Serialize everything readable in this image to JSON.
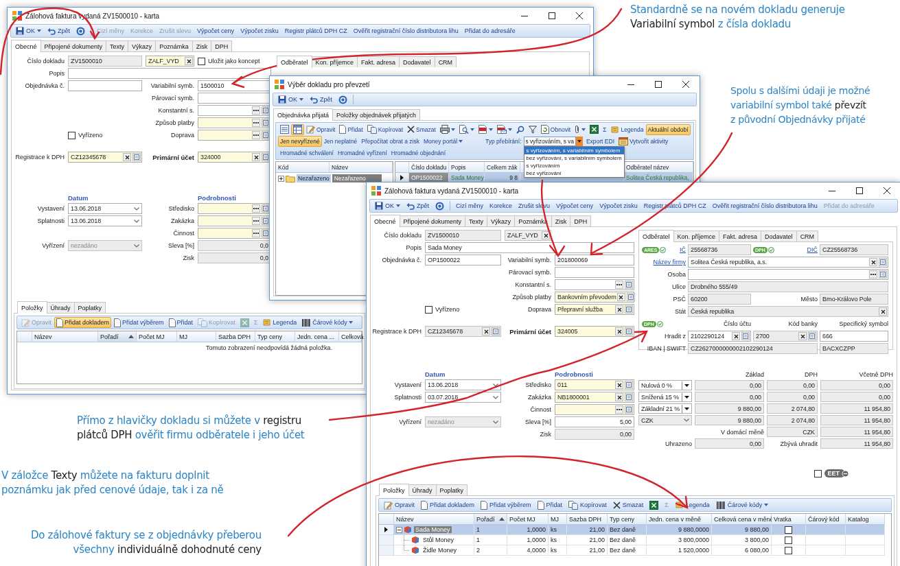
{
  "annotations": [
    {
      "lines": [
        [
          {
            "text": "Standardně se na novém dokladu generuje",
            "term": false
          }
        ],
        [
          {
            "text": "Variabilní symbol",
            "term": true
          },
          {
            "text": "z čísla dokladu",
            "term": false
          }
        ]
      ]
    },
    {
      "lines": [
        [
          {
            "text": "Spolu s dalšími údaji je možné",
            "term": false
          }
        ],
        [
          {
            "text": "variabilní symbol také",
            "term": false
          },
          {
            "text": "převzít",
            "term": true
          }
        ],
        [
          {
            "text": "z původní Objednávky přijaté",
            "term": false
          }
        ]
      ]
    },
    {
      "lines": [
        [
          {
            "text": "Přímo z hlavičky dokladu si můžete v",
            "term": false
          },
          {
            "text": "registru",
            "term": true
          }
        ],
        [
          {
            "text": "plátců DPH",
            "term": true
          },
          {
            "text": "ověřit firmu odběratele i jeho účet",
            "term": false
          }
        ]
      ]
    },
    {
      "lines": [
        [
          {
            "text": "V záložce",
            "term": false
          },
          {
            "text": "Texty",
            "term": true
          },
          {
            "text": "můžete na fakturu doplnit",
            "term": false
          }
        ],
        [
          {
            "text": "poznámku jak před cenové údaje, tak i za ně",
            "term": false
          }
        ]
      ]
    },
    {
      "lines": [
        [
          {
            "text": "Do zálohové faktury se z objednávky přeberou",
            "term": false
          }
        ],
        [
          {
            "text": "všechny",
            "term": false
          },
          {
            "text": "individuálně dohodnuté ceny",
            "term": true
          }
        ]
      ]
    }
  ],
  "invoice_window_back": {
    "title": "Zálohová faktura vydaná ZV1500010 - karta",
    "toolbar": [
      {
        "kind": "save",
        "label": "OK",
        "disabled": false
      },
      {
        "kind": "undo",
        "label": "Zpět",
        "disabled": false
      },
      {
        "kind": "help",
        "disabled": false
      },
      {
        "kind": "text",
        "label": "Cizí měny",
        "disabled": true
      },
      {
        "kind": "text",
        "label": "Korekce",
        "disabled": true
      },
      {
        "kind": "text",
        "label": "Zrušit slevu",
        "disabled": true
      },
      {
        "kind": "text",
        "label": "Výpočet ceny",
        "disabled": false
      },
      {
        "kind": "text",
        "label": "Výpočet zisku",
        "disabled": false
      },
      {
        "kind": "text",
        "label": "Registr plátců DPH CZ",
        "disabled": false
      },
      {
        "kind": "text",
        "label": "Ověřit registrační číslo distributora lihu",
        "disabled": false
      },
      {
        "kind": "text",
        "label": "Přidat do adresáře",
        "disabled": false
      }
    ],
    "tabs": [
      {
        "label": "Obecné",
        "selected": true
      },
      {
        "label": "Připojené dokumenty",
        "selected": false
      },
      {
        "label": "Texty",
        "selected": false
      },
      {
        "label": "Výkazy",
        "selected": false
      },
      {
        "label": "Poznámka",
        "selected": false
      },
      {
        "label": "Zisk",
        "selected": false
      },
      {
        "label": "DPH",
        "selected": false
      }
    ],
    "form": [
      [
        {
          "c1": {
            "kind": "label",
            "text": "Číslo dokladu",
            "bold": false
          },
          "c2": {
            "kind": "readonly",
            "value": "ZV1500010"
          },
          "c3": {
            "kind": "clear",
            "value": "ZALF_VYD",
            "required": true
          },
          "c4": {
            "kind": "check",
            "label": "Uložit jako koncept",
            "checked": false
          }
        },
        {
          "c1": {
            "kind": "label",
            "text": "Popis",
            "bold": false
          },
          "c2": {
            "kind": "text"
          }
        },
        {
          "c1": {
            "kind": "label",
            "text": "Objednávka č.",
            "bold": false
          },
          "c2": {
            "kind": "text"
          },
          "c3": {
            "kind": "label",
            "text": "Variabilní symb.",
            "bold": false
          },
          "c4": {
            "kind": "text",
            "value": "1500010"
          }
        },
        {
          "c3": {
            "kind": "label",
            "text": "Párovací symb.",
            "bold": false
          },
          "c4": {
            "kind": "text"
          }
        },
        {
          "c3": {
            "kind": "label",
            "text": "Konstantní s.",
            "bold": false
          },
          "c4": {
            "kind": "lookup_dots",
            "required": false
          }
        },
        {
          "c3": {
            "kind": "label",
            "text": "Způsob platby",
            "bold": false
          },
          "c4": {
            "kind": "lookup_dots",
            "required": true
          }
        },
        {
          "c2": {
            "kind": "check",
            "label": "Vyřízeno",
            "checked": false
          },
          "c3": {
            "kind": "label",
            "text": "Doprava",
            "bold": false
          },
          "c4": {
            "kind": "lookup_dots",
            "required": true
          }
        }
      ],
      [
        {
          "c1": {
            "kind": "label",
            "text": "Registrace k DPH",
            "bold": false
          },
          "c2": {
            "kind": "lookup_x",
            "value": "CZ12345678",
            "required": true
          },
          "c3": {
            "kind": "label",
            "text": "Primární účet",
            "bold": true
          },
          "c4": {
            "kind": "lookup_x",
            "value": "324000",
            "required": true
          }
        }
      ]
    ],
    "partner_tabs": [
      {
        "label": "Odběratel",
        "selected": true
      },
      {
        "label": "Kon. příjemce",
        "selected": false
      },
      {
        "label": "Fakt. adresa",
        "selected": false
      },
      {
        "label": "Dodavatel",
        "selected": false
      },
      {
        "label": "CRM",
        "selected": false
      }
    ],
    "dates": [
      [
        {
          "c2": {
            "kind": "heading",
            "text": "Datum"
          },
          "c4": {
            "kind": "heading",
            "text": "Podrobnosti"
          }
        },
        {
          "c1": {
            "kind": "label",
            "text": "Vystavení"
          },
          "c2": {
            "kind": "date",
            "value": "13.06.2018"
          },
          "c3": {
            "kind": "label",
            "text": "Středisko"
          },
          "c4": {
            "kind": "lookup_dots",
            "required": true
          }
        },
        {
          "c1": {
            "kind": "label",
            "text": "Splatnosti"
          },
          "c2": {
            "kind": "date",
            "value": "13.06.2018"
          },
          "c3": {
            "kind": "label",
            "text": "Zakázka"
          },
          "c4": {
            "kind": "lookup_dots",
            "required": true
          }
        },
        {
          "c3": {
            "kind": "label",
            "text": "Činnost"
          },
          "c4": {
            "kind": "lookup_dots",
            "required": true
          }
        },
        {
          "c1": {
            "kind": "label",
            "text": "Vyřízení"
          },
          "c2": {
            "kind": "select_disabled",
            "value": "nezadáno"
          },
          "c3": {
            "kind": "label",
            "text": "Sleva [%]"
          },
          "c4": {
            "kind": "number_ro",
            "value": "0,0"
          }
        },
        {
          "c3": {
            "kind": "label",
            "text": "Zisk"
          },
          "c4": {
            "kind": "number_ro",
            "value": "0,0"
          }
        }
      ]
    ],
    "items_tabs": [
      {
        "label": "Položky",
        "selected": true
      },
      {
        "label": "Úhrady",
        "selected": false
      },
      {
        "label": "Poplatky",
        "selected": false
      }
    ],
    "items_toolbar": [
      {
        "kind": "edit",
        "label": "Opravit",
        "disabled": true,
        "active": false
      },
      {
        "kind": "add",
        "label": "Přidat dokladem",
        "disabled": false,
        "active": true
      },
      {
        "kind": "add",
        "label": "Přidat výběrem",
        "disabled": false,
        "active": false
      },
      {
        "kind": "add",
        "label": "Přidat",
        "disabled": false,
        "active": false
      },
      {
        "kind": "copy",
        "label": "Kopírovat",
        "disabled": true,
        "active": false
      },
      {
        "kind": "excel",
        "disabled": true,
        "active": false
      },
      {
        "kind": "sum",
        "label": "Σ",
        "disabled": true,
        "active": false
      },
      {
        "kind": "legend",
        "label": "Legenda",
        "disabled": false,
        "active": false
      },
      {
        "kind": "barcode",
        "label": "Čárové kódy",
        "disabled": false,
        "active": false
      }
    ],
    "items_table": {
      "columns": [
        {
          "label": "Název",
          "sorted": false
        },
        {
          "label": "Pořadí",
          "sorted": true
        },
        {
          "label": "Počet MJ",
          "sorted": false
        },
        {
          "label": "MJ",
          "sorted": false
        },
        {
          "label": "Sazba DPH",
          "sorted": false
        },
        {
          "label": "Typ ceny",
          "sorted": false
        },
        {
          "label": "Jedn. cena ...",
          "sorted": false
        },
        {
          "label": "Celková",
          "sorted": false
        }
      ],
      "empty_message": "Tomuto zobrazení neodpovídá žádná položka."
    }
  },
  "selection_window": {
    "title": "Výběr dokladu pro převzetí",
    "toolbar": [
      {
        "kind": "save",
        "label": "OK",
        "disabled": false
      },
      {
        "kind": "undo",
        "label": "Zpět",
        "disabled": false
      },
      {
        "kind": "help",
        "disabled": false
      }
    ],
    "tabs": [
      {
        "label": "Objednávka přijatá",
        "selected": true
      },
      {
        "label": "Položky objednávek přijatých",
        "selected": false
      }
    ],
    "toolbar_rows": [
      [
        {
          "kind": "view_list",
          "active": false
        },
        {
          "kind": "view_tree",
          "active": true
        },
        {
          "kind": "edit",
          "label": "Opravit",
          "active": false
        },
        {
          "kind": "add",
          "label": "Přidat",
          "active": false
        },
        {
          "kind": "copy",
          "label": "Kopírovat",
          "active": false
        },
        {
          "kind": "delete",
          "label": "Smazat",
          "active": false
        },
        {
          "kind": "print",
          "active": false
        },
        {
          "kind": "preview",
          "active": false
        },
        {
          "kind": "pdf",
          "active": false
        },
        {
          "kind": "pdf_mail",
          "active": false
        },
        {
          "kind": "find",
          "active": false
        },
        {
          "kind": "filter",
          "active": false
        },
        {
          "kind": "refresh",
          "label": "Obnovit",
          "active": false
        },
        {
          "kind": "attach",
          "active": false
        },
        {
          "kind": "excel",
          "active": false
        },
        {
          "kind": "sum",
          "label": "Σ",
          "active": false
        },
        {
          "kind": "legend",
          "label": "Legenda",
          "active": false
        },
        {
          "kind": "text",
          "label": "Aktuální období",
          "active": true
        }
      ],
      [
        {
          "kind": "text",
          "label": "Jen nevyřízené",
          "active": true
        },
        {
          "kind": "text",
          "label": "Jen neplatné",
          "active": false
        },
        {
          "kind": "text",
          "label": "Přepočítat obrat a zisk",
          "active": false
        },
        {
          "kind": "dropdown",
          "label": "Money portál",
          "active": false
        },
        {
          "kind": "combo",
          "label": "Typ přebírání:",
          "value": "s vyřizováním, s va",
          "expanded": true,
          "options": [
            {
              "label": "s vyřizováním, s variabilním symbolem",
              "selected": true
            },
            {
              "label": "bez vyřizování, s variabilním symbolem",
              "selected": false
            },
            {
              "label": "s vyřizováním",
              "selected": false
            },
            {
              "label": "bez vyřizování",
              "selected": false
            }
          ]
        },
        {
          "kind": "text",
          "label": "Export EDI",
          "active": false
        },
        {
          "kind": "activity",
          "label": "Vytvořit aktivity",
          "active": false
        }
      ],
      [
        {
          "kind": "text",
          "label": "Hromadné schválení",
          "active": false
        },
        {
          "kind": "text",
          "label": "Hromadné vyřízení",
          "active": false
        },
        {
          "kind": "text",
          "label": "Hromadné objednání",
          "active": false
        }
      ]
    ],
    "tree": {
      "columns": [
        "Kód",
        "Název"
      ],
      "rows": [
        {
          "code": "Nezařazeno",
          "name": "Nezařazeno",
          "expanded": false,
          "selected": true
        }
      ]
    },
    "grid": {
      "columns": [
        "Číslo dokladu",
        "Popis",
        "Celkem zák",
        "Odběratel název"
      ],
      "rows": [
        {
          "cells": [
            "OP1500022",
            "Sada Money",
            "9 8",
            "Solitea Česká republika,"
          ],
          "selected": true
        }
      ]
    }
  },
  "invoice_window_front": {
    "title": "Zálohová faktura vydaná ZV1500010 - karta",
    "toolbar": [
      {
        "kind": "save",
        "label": "OK",
        "disabled": false
      },
      {
        "kind": "undo",
        "label": "Zpět",
        "disabled": false
      },
      {
        "kind": "help",
        "disabled": false
      },
      {
        "kind": "text",
        "label": "Cizí měny",
        "disabled": false
      },
      {
        "kind": "text",
        "label": "Korekce",
        "disabled": false
      },
      {
        "kind": "text",
        "label": "Zrušit slevu",
        "disabled": false
      },
      {
        "kind": "text",
        "label": "Výpočet ceny",
        "disabled": false
      },
      {
        "kind": "text",
        "label": "Výpočet zisku",
        "disabled": false
      },
      {
        "kind": "text",
        "label": "Registr plátců DPH CZ",
        "disabled": false
      },
      {
        "kind": "text",
        "label": "Ověřit registrační číslo distributora lihu",
        "disabled": false
      },
      {
        "kind": "text",
        "label": "Přidat do adresáře",
        "disabled": true
      }
    ],
    "tabs": [
      {
        "label": "Obecné",
        "selected": true
      },
      {
        "label": "Připojené dokumenty",
        "selected": false
      },
      {
        "label": "Texty",
        "selected": false
      },
      {
        "label": "Výkazy",
        "selected": false
      },
      {
        "label": "Poznámka",
        "selected": false
      },
      {
        "label": "Zisk",
        "selected": false
      },
      {
        "label": "DPH",
        "selected": false
      }
    ],
    "form": [
      [
        {
          "c1": {
            "kind": "label",
            "text": "Číslo dokladu",
            "bold": false
          },
          "c2": {
            "kind": "readonly",
            "value": "ZV1500010"
          },
          "c3": {
            "kind": "readonly_x",
            "value": "ZALF_VYD"
          }
        },
        {
          "c1": {
            "kind": "label",
            "text": "Popis",
            "bold": false
          },
          "c2": {
            "kind": "text",
            "value": "Sada Money"
          }
        },
        {
          "c1": {
            "kind": "label",
            "text": "Objednávka č.",
            "bold": false
          },
          "c2": {
            "kind": "text",
            "value": "OP1500022"
          },
          "c3": {
            "kind": "label",
            "text": "Variabilní symb.",
            "bold": false
          },
          "c4": {
            "kind": "text",
            "value": "201800069"
          }
        },
        {
          "c3": {
            "kind": "label",
            "text": "Párovací symb.",
            "bold": false
          },
          "c4": {
            "kind": "text"
          }
        },
        {
          "c3": {
            "kind": "label",
            "text": "Konstantní s.",
            "bold": false
          },
          "c4": {
            "kind": "lookup_dots",
            "required": false
          }
        },
        {
          "c3": {
            "kind": "label",
            "text": "Způsob platby",
            "bold": false
          },
          "c4": {
            "kind": "lookup_x",
            "value": "Bankovním převodem",
            "required": true
          }
        },
        {
          "c2": {
            "kind": "check",
            "label": "Vyřízeno",
            "checked": false
          },
          "c3": {
            "kind": "label",
            "text": "Doprava",
            "bold": false
          },
          "c4": {
            "kind": "lookup_x",
            "value": "Přepravní služba",
            "required": true
          }
        }
      ],
      [
        {
          "c1": {
            "kind": "label",
            "text": "Registrace k DPH",
            "bold": false
          },
          "c2": {
            "kind": "readonly_xl",
            "value": "CZ12345678"
          },
          "c3": {
            "kind": "label",
            "text": "Primární účet",
            "bold": true
          },
          "c4": {
            "kind": "lookup_x",
            "value": "324005",
            "required": true
          }
        }
      ]
    ],
    "partner_tabs": [
      {
        "label": "Odběratel",
        "selected": true
      },
      {
        "label": "Kon. příjemce",
        "selected": false
      },
      {
        "label": "Fakt. adresa",
        "selected": false
      },
      {
        "label": "Dodavatel",
        "selected": false
      },
      {
        "label": "CRM",
        "selected": false
      }
    ],
    "partner_form": [
      [
        {
          "c1": {
            "kind": "label",
            "badge": "ARES",
            "text": "IČ",
            "link": true
          },
          "c2": {
            "kind": "readonly",
            "value": "25568736"
          },
          "c3": {
            "kind": "label",
            "badge": "DPH",
            "text": "DIČ",
            "link": true
          },
          "c4": {
            "kind": "readonly",
            "value": "CZ25568736"
          }
        },
        {
          "c1": {
            "kind": "label",
            "text": "Název firmy",
            "link": true
          },
          "c2": {
            "kind": "lookup_x",
            "value": "Solitea Česká republika, a.s."
          }
        },
        {
          "c1": {
            "kind": "label",
            "text": "Osoba",
            "link": false
          },
          "c2": {
            "kind": "lookup_dots"
          }
        },
        {
          "c1": {
            "kind": "label",
            "text": "Ulice",
            "link": false
          },
          "c2": {
            "kind": "readonly",
            "value": "Drobného 555/49"
          }
        },
        {
          "c1": {
            "kind": "label",
            "text": "PSČ",
            "link": false
          },
          "c2": {
            "kind": "readonly",
            "value": "60200"
          },
          "c3": {
            "kind": "label",
            "text": "Město",
            "link": false
          },
          "c4": {
            "kind": "readonly",
            "value": "Brno-Královo Pole"
          }
        },
        {
          "c1": {
            "kind": "label",
            "text": "Stát",
            "link": false
          },
          "c2": {
            "kind": "readonly_x",
            "value": "Česká republika"
          }
        },
        {
          "c1": {
            "kind": "label",
            "badge": "DPH"
          },
          "c2": {
            "kind": "colhead",
            "text": "Číslo účtu"
          },
          "c3": {
            "kind": "colhead",
            "text": "Kód banky"
          },
          "c4": {
            "kind": "colhead",
            "text": "Specifický symbol"
          }
        },
        {
          "c1": {
            "kind": "label",
            "text": "Hradit z",
            "link": false
          },
          "c2": {
            "kind": "lookup_x",
            "value": "2102290124"
          },
          "c3": {
            "kind": "readonly_xl",
            "value": "2700"
          },
          "c4": {
            "kind": "text",
            "value": "666"
          }
        },
        {
          "c1": {
            "kind": "label",
            "text": "IBAN | SWIFT",
            "link": false
          },
          "c2": {
            "kind": "readonly",
            "value": "CZ2627000000002102290124"
          },
          "c4": {
            "kind": "readonly",
            "value": "BACXCZPP"
          }
        }
      ]
    ],
    "dates": [
      [
        {
          "c2": {
            "kind": "heading",
            "text": "Datum"
          },
          "c4": {
            "kind": "heading",
            "text": "Podrobnosti"
          }
        },
        {
          "c1": {
            "kind": "label",
            "text": "Vystavení"
          },
          "c2": {
            "kind": "date",
            "value": "13.06.2018"
          },
          "c3": {
            "kind": "label",
            "text": "Středisko"
          },
          "c4": {
            "kind": "lookup_x",
            "value": "011",
            "required": true
          }
        },
        {
          "c1": {
            "kind": "label",
            "text": "Splatnosti"
          },
          "c2": {
            "kind": "date",
            "value": "03.07.2018"
          },
          "c3": {
            "kind": "label",
            "text": "Zakázka"
          },
          "c4": {
            "kind": "lookup_x",
            "value": "NB1800001",
            "required": true
          }
        },
        {
          "c3": {
            "kind": "label",
            "text": "Činnost"
          },
          "c4": {
            "kind": "lookup_dots",
            "required": true
          }
        },
        {
          "c1": {
            "kind": "label",
            "text": "Vyřízení"
          },
          "c2": {
            "kind": "select_disabled",
            "value": "nezadáno"
          },
          "c3": {
            "kind": "label",
            "text": "Sleva [%]"
          },
          "c4": {
            "kind": "number",
            "value": "5,00"
          }
        },
        {
          "c3": {
            "kind": "label",
            "text": "Zisk"
          },
          "c4": {
            "kind": "number_ro",
            "value": "0,00"
          }
        }
      ]
    ],
    "vat": [
      [
        {
          "c2": {
            "kind": "colhead",
            "text": "Základ"
          },
          "c3": {
            "kind": "colhead",
            "text": "DPH"
          },
          "c4": {
            "kind": "colhead",
            "text": "Včetně DPH"
          }
        },
        {
          "c1": {
            "kind": "rate",
            "value": "Nulová 0 %"
          },
          "c2": {
            "kind": "number_ro",
            "value": "0,00"
          },
          "c3": {
            "kind": "number_ro",
            "value": "0,00"
          },
          "c4": {
            "kind": "number_ro",
            "value": "0,00"
          }
        },
        {
          "c1": {
            "kind": "rate",
            "value": "Snížená 15 %"
          },
          "c2": {
            "kind": "number_ro",
            "value": "0,00"
          },
          "c3": {
            "kind": "number_ro",
            "value": "0,00"
          },
          "c4": {
            "kind": "number_ro",
            "value": "0,00"
          }
        },
        {
          "c1": {
            "kind": "rate",
            "value": "Základní 21 %"
          },
          "c2": {
            "kind": "number_ro",
            "value": "9 880,00"
          },
          "c3": {
            "kind": "number_ro",
            "value": "2 074,80"
          },
          "c4": {
            "kind": "number_ro",
            "value": "11 954,80"
          }
        },
        {
          "c1": {
            "kind": "select_ro",
            "value": "CZK"
          },
          "c2": {
            "kind": "number_ro",
            "value": "9 880,00"
          },
          "c3": {
            "kind": "number_ro",
            "value": "2 074,80"
          },
          "c4": {
            "kind": "number_ro",
            "value": "11 954,80"
          }
        },
        {
          "c2": {
            "kind": "label",
            "text": "V domácí měně"
          },
          "c3": {
            "kind": "number_ro",
            "value": "CZK"
          },
          "c4": {
            "kind": "number_ro",
            "value": "11 954,80"
          }
        },
        {
          "c1": {
            "kind": "label",
            "text": "Uhrazeno"
          },
          "c2": {
            "kind": "number_ro",
            "value": "0,00"
          },
          "c3": {
            "kind": "label",
            "text": "Zbývá uhradit"
          },
          "c4": {
            "kind": "number_ro",
            "value": "11 954,80"
          }
        }
      ]
    ],
    "eet": {
      "label": "EET",
      "checked": false
    },
    "items_tabs": [
      {
        "label": "Položky",
        "selected": true
      },
      {
        "label": "Úhrady",
        "selected": false
      },
      {
        "label": "Poplatky",
        "selected": false
      }
    ],
    "items_toolbar": [
      {
        "kind": "edit",
        "label": "Opravit",
        "disabled": false
      },
      {
        "kind": "add",
        "label": "Přidat dokladem",
        "disabled": false
      },
      {
        "kind": "add",
        "label": "Přidat výběrem",
        "disabled": false
      },
      {
        "kind": "add",
        "label": "Přidat",
        "disabled": false
      },
      {
        "kind": "copy",
        "label": "Kopírovat",
        "disabled": false
      },
      {
        "kind": "delete",
        "label": "Smazat",
        "disabled": false
      },
      {
        "kind": "excel",
        "disabled": false
      },
      {
        "kind": "sum",
        "label": "Σ",
        "disabled": true
      },
      {
        "kind": "legend",
        "label": "Legenda",
        "disabled": false
      },
      {
        "kind": "barcode",
        "label": "Čárové kódy",
        "disabled": false
      }
    ],
    "items_table": {
      "columns": [
        {
          "label": "Název",
          "sorted": false
        },
        {
          "label": "Pořadí",
          "sorted": true
        },
        {
          "label": "Počet MJ",
          "sorted": false
        },
        {
          "label": "MJ",
          "sorted": false
        },
        {
          "label": "Sazba DPH",
          "sorted": false
        },
        {
          "label": "Typ ceny",
          "sorted": false
        },
        {
          "label": "Jedn. cena v měně",
          "sorted": false
        },
        {
          "label": "Celková cena v měně",
          "sorted": false
        },
        {
          "label": "Vratka",
          "sorted": false
        },
        {
          "label": "Čárový kód",
          "sorted": false
        },
        {
          "label": "Katalog",
          "sorted": false
        }
      ],
      "rows": [
        {
          "cells": [
            "Sada Money",
            "1",
            "1,0000",
            "ks",
            "21,00",
            "Bez daně",
            "9 880,0000",
            "9 880,00"
          ],
          "returned": false,
          "selected": true,
          "expanded": true,
          "children": [
            {
              "cells": [
                "Stůl Money",
                "1",
                "1,0000",
                "ks",
                "21,00",
                "Bez daně",
                "3 800,0000",
                "3 800,00"
              ],
              "returned": false,
              "selected": false
            },
            {
              "cells": [
                "Židle Money",
                "2",
                "4,0000",
                "ks",
                "21,00",
                "Bez daně",
                "1 520,0000",
                "6 080,00"
              ],
              "returned": false,
              "selected": false
            }
          ]
        }
      ]
    }
  }
}
